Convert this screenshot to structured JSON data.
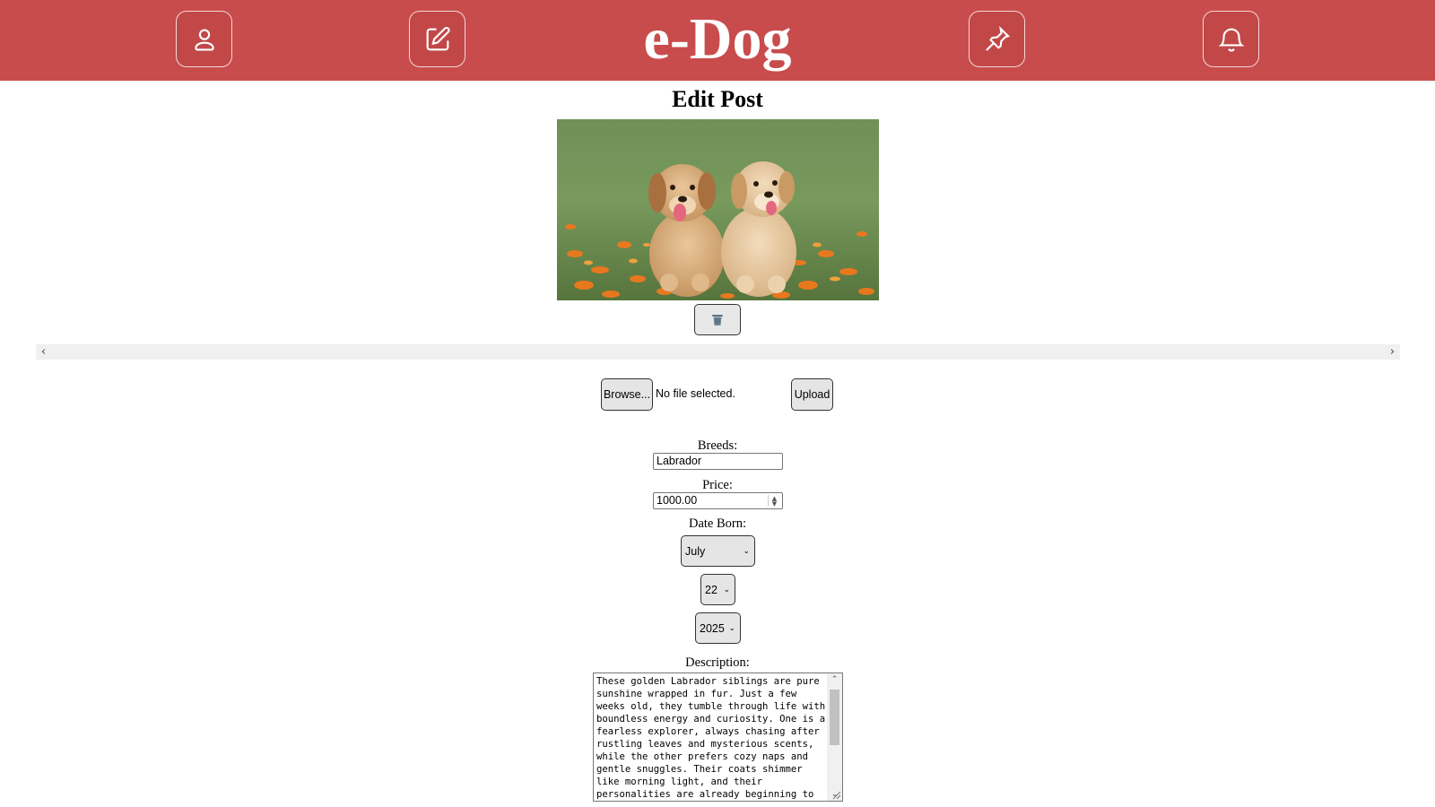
{
  "app": {
    "brand": "e-Dog"
  },
  "nav": {
    "profile_icon": "user-icon",
    "edit_icon": "pencil-square-icon",
    "pin_icon": "pin-icon",
    "bell_icon": "bell-icon"
  },
  "page": {
    "title": "Edit Post"
  },
  "photo": {
    "icon": "trash-icon"
  },
  "upload": {
    "browse_label": "Browse...",
    "file_status": "No file selected.",
    "upload_label": "Upload"
  },
  "form": {
    "breeds_label": "Breeds:",
    "breeds_value": "Labrador",
    "price_label": "Price:",
    "price_value": "1000.00",
    "date_label": "Date Born:",
    "month": "July",
    "day": "22",
    "year": "2025",
    "description_label": "Description:",
    "description_value": "These golden Labrador siblings are pure sunshine wrapped in fur. Just a few weeks old, they tumble through life with boundless energy and curiosity. One is a fearless explorer, always chasing after rustling leaves and mysterious scents, while the other prefers cozy naps and gentle snuggles. Their coats shimmer like morning light, and their personalities are already beginning to"
  },
  "colors": {
    "navbar": "#c94c4c",
    "nav_button": "#c24848",
    "brand_text": "#ffffff",
    "button_bg": "#e5e5e5"
  }
}
